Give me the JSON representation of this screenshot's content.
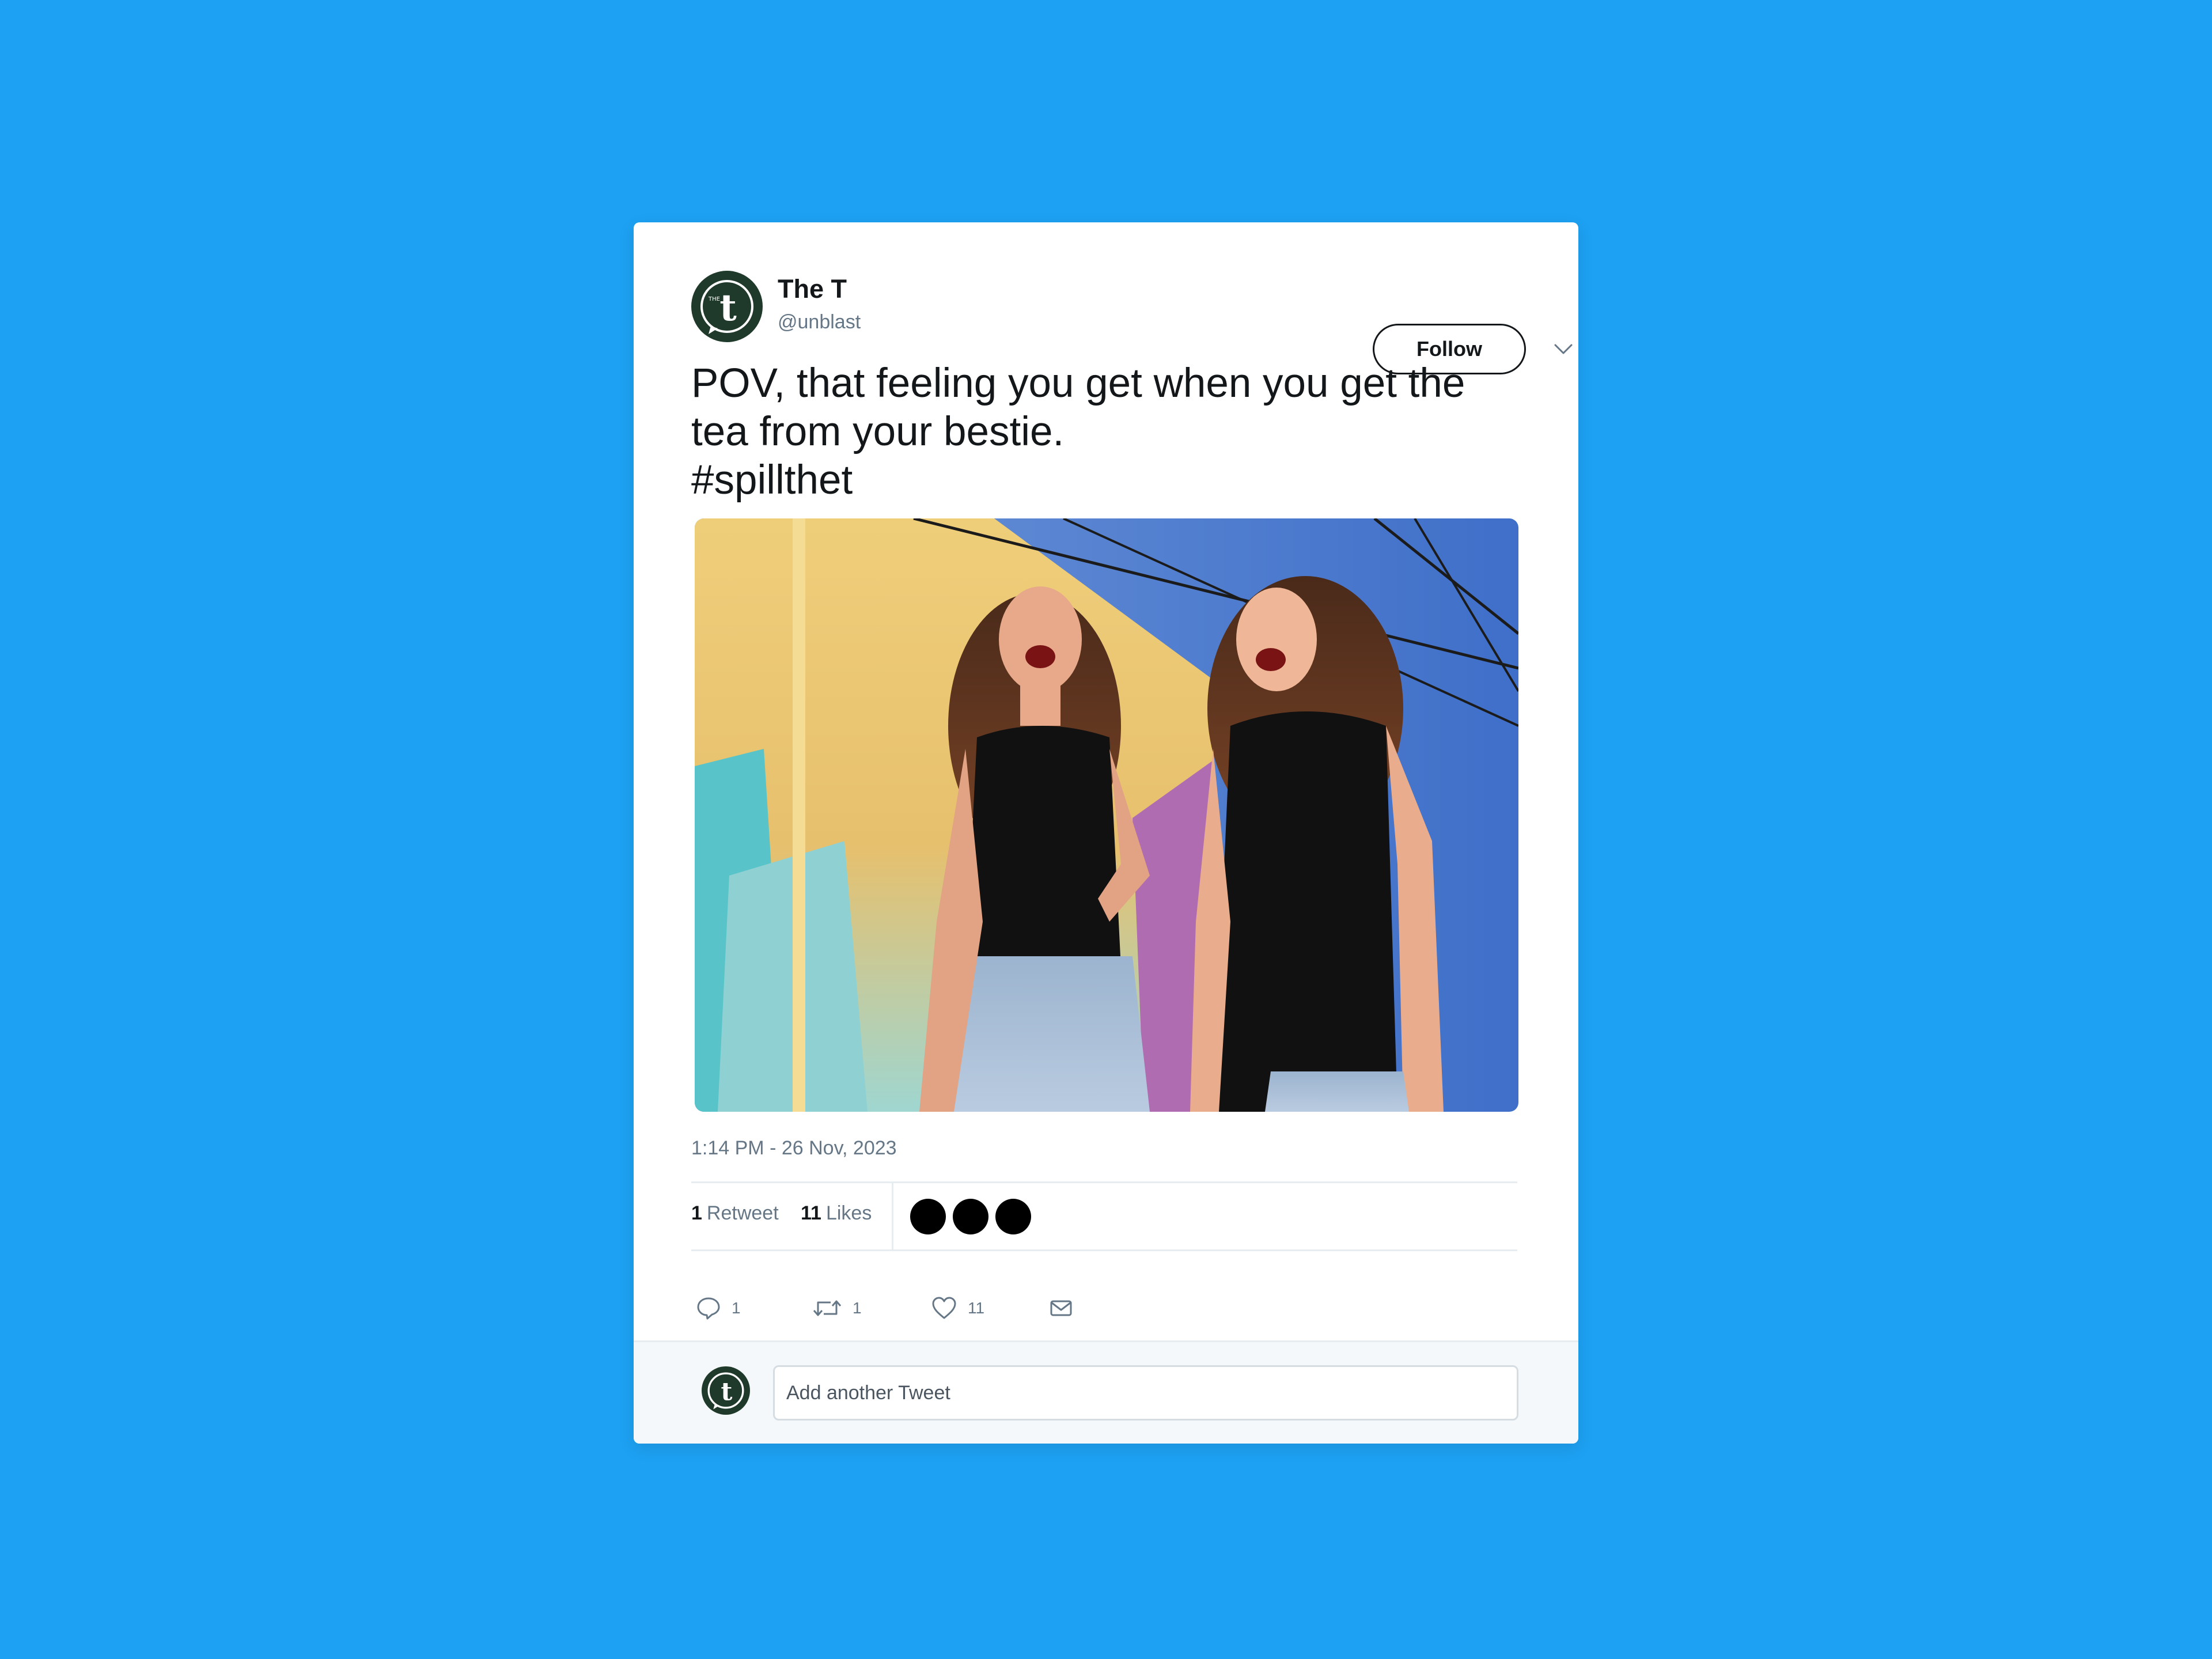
{
  "tweet": {
    "user": {
      "name": "The T",
      "handle": "@unblast",
      "avatar_icon": "the-t-logo"
    },
    "follow_label": "Follow",
    "text_lines": [
      "POV, that feeling you get when you get the",
      "tea from your bestie.",
      "#spillthet"
    ],
    "timestamp": "1:14 PM - 26 Nov, 2023",
    "stats": {
      "retweets": {
        "count": "1",
        "label": "Retweet"
      },
      "likes": {
        "count": "11",
        "label": "Likes"
      }
    },
    "actions": {
      "reply": {
        "icon": "reply-icon",
        "count": "1"
      },
      "retweet": {
        "icon": "retweet-icon",
        "count": "1"
      },
      "like": {
        "icon": "heart-icon",
        "count": "11"
      },
      "message": {
        "icon": "mail-icon"
      }
    },
    "reply_box": {
      "placeholder": "Add another Tweet"
    }
  },
  "colors": {
    "page_background": "#1da1f2",
    "card": "#ffffff",
    "avatar": "#1f3a2a",
    "text": "#14171a",
    "muted": "#657786"
  }
}
